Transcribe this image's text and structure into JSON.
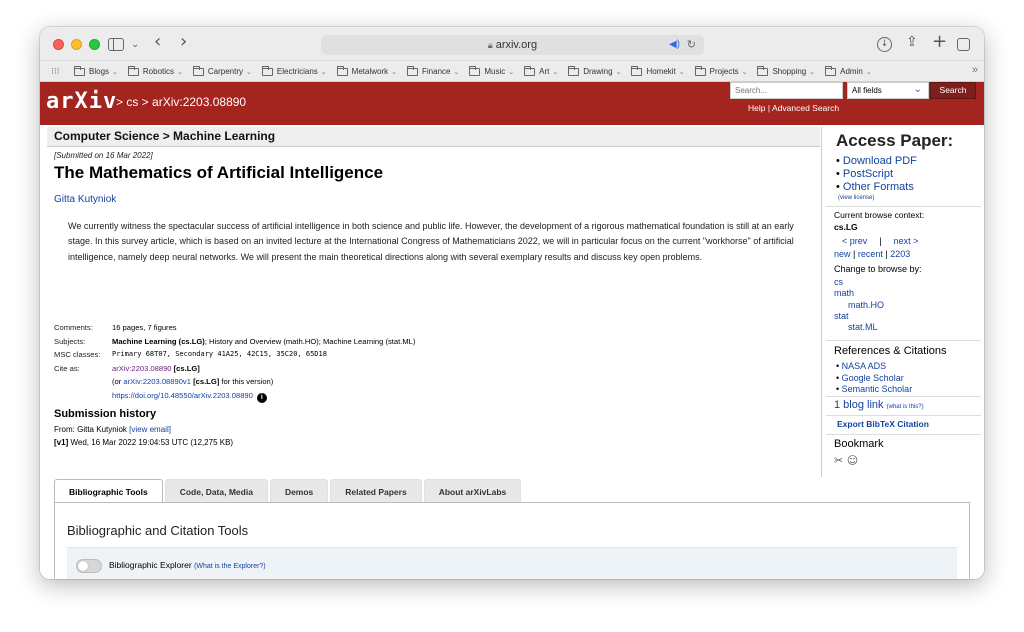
{
  "browser": {
    "url": "arxiv.org",
    "bookmarks": [
      "Blogs",
      "Robotics",
      "Carpentry",
      "Electricians",
      "Metalwork",
      "Finance",
      "Music",
      "Art",
      "Drawing",
      "Homekit",
      "Projects",
      "Shopping",
      "Admin"
    ],
    "more": "»"
  },
  "header": {
    "logo": "arXiv",
    "breadcrumb": "> cs > arXiv:2203.08890",
    "search_placeholder": "Search...",
    "search_field": "All fields",
    "search_button": "Search",
    "help": "Help",
    "advanced_search": "Advanced Search",
    "help_sep": "|"
  },
  "paper": {
    "subject_bar": "Computer Science > Machine Learning",
    "submitted": "[Submitted on 16 Mar 2022]",
    "title": "The Mathematics of Artificial Intelligence",
    "author": "Gitta Kutyniok",
    "abstract": "We currently witness the spectacular success of artificial intelligence in both science and public life. However, the development of a rigorous mathematical foundation is still at an early stage. In this survey article, which is based on an invited lecture at the International Congress of Mathematicians 2022, we will in particular focus on the current \"workhorse\" of artificial intelligence, namely deep neural networks. We will present the main theoretical directions along with several exemplary results and discuss key open problems."
  },
  "meta": {
    "comments_key": "Comments:",
    "comments_val": "16 pages, 7 figures",
    "subjects_key": "Subjects:",
    "subjects_primary": "Machine Learning (cs.LG)",
    "subjects_rest": "; History and Overview (math.HO); Machine Learning (stat.ML)",
    "msc_key": "MSC classes:",
    "msc_val": "Primary 68T07, Secondary 41A25, 42C15, 35C20, 65D18",
    "cite_key": "Cite as:",
    "cite_id": "arXiv:2203.08890",
    "cite_cat": "[cs.LG]",
    "cite_or_prefix": "(or",
    "cite_version": "arXiv:2203.08890v1",
    "cite_version_cat": "[cs.LG]",
    "cite_version_suffix": "for this version)",
    "doi": "https://doi.org/10.48550/arXiv.2203.08890",
    "info_icon": "i"
  },
  "history": {
    "title": "Submission history",
    "from_prefix": "From: Gitta Kutyniok",
    "view_email": "[view email]",
    "v1_label": "[v1]",
    "v1_text": "Wed, 16 Mar 2022 19:04:53 UTC (12,275 KB)"
  },
  "sidebar": {
    "access_title": "Access Paper:",
    "download_pdf": "Download PDF",
    "postscript": "PostScript",
    "other_formats": "Other Formats",
    "view_license": "(view license)",
    "browse_context": "Current browse context:",
    "browse_cat": "cs.LG",
    "prev": "< prev",
    "nav_sep": "|",
    "next": "next >",
    "new": "new",
    "recent": "recent",
    "month": "2203",
    "bar": "|",
    "change_browse": "Change to browse by:",
    "browse_cs": "cs",
    "browse_math": "math",
    "browse_mathho": "math.HO",
    "browse_stat": "stat",
    "browse_statml": "stat.ML",
    "refs_title": "References & Citations",
    "nasa_ads": "NASA ADS",
    "google_scholar": "Google Scholar",
    "semantic_scholar": "Semantic Scholar",
    "blog_link": "1 blog link",
    "what_is_this": "(what is this?)",
    "bibtex": "Export BibTeX Citation",
    "bookmark_title": "Bookmark"
  },
  "labs": {
    "tabs": [
      "Bibliographic Tools",
      "Code, Data, Media",
      "Demos",
      "Related Papers",
      "About arXivLabs"
    ],
    "active_tab": "Bibliographic Tools",
    "heading": "Bibliographic and Citation Tools",
    "explorer_label": "Bibliographic Explorer",
    "explorer_link": "(What is the Explorer?)"
  },
  "colors": {
    "arxiv_red": "#a4241f",
    "link_blue": "#1343a0",
    "link_purple": "#6a1b7e"
  }
}
